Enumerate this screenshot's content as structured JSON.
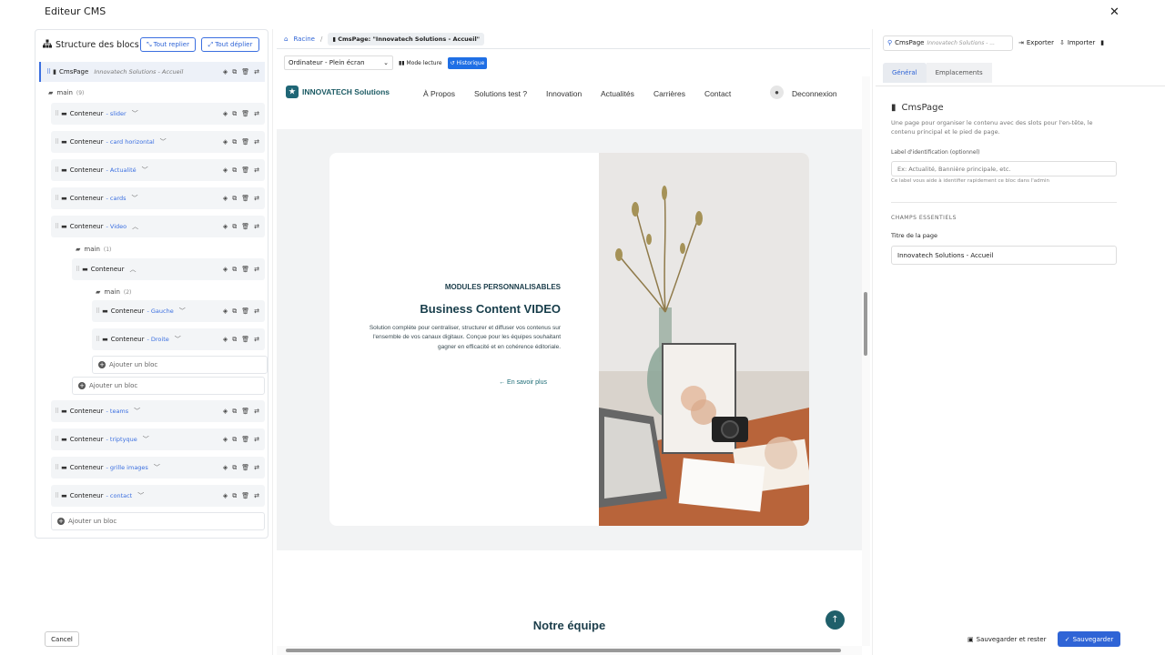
{
  "app": {
    "title": "Editeur CMS",
    "close": "✕"
  },
  "left": {
    "title": "Structure des blocs",
    "collapse_all": "Tout replier",
    "expand_all": "Tout déplier",
    "root": {
      "type": "CmsPage",
      "sub": "Innovatech Solutions - Accueil"
    },
    "main": {
      "label": "main",
      "count": "(9)"
    },
    "blocks": [
      {
        "label": "Conteneur",
        "sub": "- slider"
      },
      {
        "label": "Conteneur",
        "sub": "- card horizontal"
      },
      {
        "label": "Conteneur",
        "sub": "- Actualité"
      },
      {
        "label": "Conteneur",
        "sub": "- cards"
      },
      {
        "label": "Conteneur",
        "sub": "- Video"
      },
      {
        "label": "Conteneur",
        "sub": "- teams"
      },
      {
        "label": "Conteneur",
        "sub": "- triptyque"
      },
      {
        "label": "Conteneur",
        "sub": "- grille images"
      },
      {
        "label": "Conteneur",
        "sub": "- contact"
      }
    ],
    "video_main": {
      "label": "main",
      "count": "(1)"
    },
    "inner_container": {
      "label": "Conteneur"
    },
    "inner_main": {
      "label": "main",
      "count": "(2)"
    },
    "inner_blocks": [
      {
        "label": "Conteneur",
        "sub": "- Gauche"
      },
      {
        "label": "Conteneur",
        "sub": "- Droite"
      }
    ],
    "add_block": "Ajouter un bloc",
    "cancel": "Cancel"
  },
  "center": {
    "breadcrumb_root": "Racine",
    "breadcrumb_sep": "/",
    "breadcrumb_current": "CmsPage: \"Innovatech Solutions - Accueil\"",
    "device_select": "Ordinateur - Plein écran",
    "reading_mode": "Mode lecture",
    "history": "Historique",
    "site": {
      "logo": "INNOVATECH Solutions",
      "nav": [
        "À Propos",
        "Solutions test ?",
        "Innovation",
        "Actualités",
        "Carrières",
        "Contact"
      ],
      "logout": "Deconnexion",
      "eyebrow": "MODULES PERSONNALISABLES",
      "heading": "Business Content VIDEO",
      "paragraph": "Solution complète pour centraliser, structurer et diffuser vos contenus sur l'ensemble de vos canaux digitaux. Conçue pour les équipes souhaitant gagner en efficacité et en cohérence éditoriale.",
      "more": "En savoir plus",
      "section_title": "Notre équipe"
    }
  },
  "right": {
    "chip_type": "CmsPage",
    "chip_sub": "Innovatech Solutions - ...",
    "export": "Exporter",
    "import": "Importer",
    "tabs": [
      "Général",
      "Emplacements"
    ],
    "title": "CmsPage",
    "description": "Une page pour organiser le contenu avec des slots pour l'en-tête, le contenu principal et le pied de page.",
    "id_label": "Label d'identification (optionnel)",
    "id_placeholder": "Ex: Actualité, Bannière principale, etc.",
    "id_hint": "Ce label vous aide à identifier rapidement ce bloc dans l'admin",
    "section": "CHAMPS ESSENTIELS",
    "page_title_label": "Titre de la page",
    "page_title_value": "Innovatech Solutions - Accueil",
    "save_stay": "Sauvegarder et rester",
    "save": "Sauvegarder"
  }
}
